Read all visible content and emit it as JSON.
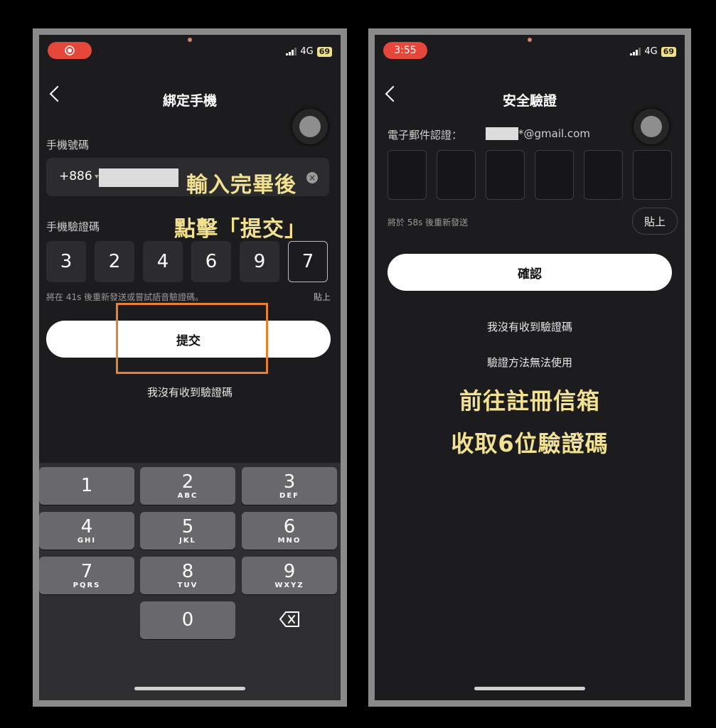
{
  "left": {
    "status": {
      "network": "4G",
      "battery": "69"
    },
    "title": "綁定手機",
    "phone_label": "手機號碼",
    "country_code": "+886",
    "annotation_line1": "輸入完畢後",
    "annotation_line2": "點擊「提交」",
    "code_label": "手機驗證碼",
    "code_digits": [
      "3",
      "2",
      "4",
      "6",
      "9",
      "7"
    ],
    "resend_hint": "將在 41s 後重新發送或嘗試語音驗證碼。",
    "paste_label": "貼上",
    "submit_label": "提交",
    "no_code_label": "我沒有收到驗證碼",
    "keypad": [
      {
        "num": "1",
        "letters": ""
      },
      {
        "num": "2",
        "letters": "ABC"
      },
      {
        "num": "3",
        "letters": "DEF"
      },
      {
        "num": "4",
        "letters": "GHI"
      },
      {
        "num": "5",
        "letters": "JKL"
      },
      {
        "num": "6",
        "letters": "MNO"
      },
      {
        "num": "7",
        "letters": "PQRS"
      },
      {
        "num": "8",
        "letters": "TUV"
      },
      {
        "num": "9",
        "letters": "WXYZ"
      },
      {
        "num": "0",
        "letters": ""
      }
    ]
  },
  "right": {
    "status": {
      "time": "3:55",
      "network": "4G",
      "battery": "69"
    },
    "title": "安全驗證",
    "email_label": "電子郵件認證：",
    "email_suffix": "*@gmail.com",
    "resend_hint": "將於 58s 後重新發送",
    "paste_label": "貼上",
    "confirm_label": "確認",
    "no_code_label": "我沒有收到驗證碼",
    "method_unavailable_label": "驗證方法無法使用",
    "annotation_line1": "前往註冊信箱",
    "annotation_line2": "收取6位驗證碼"
  },
  "colors": {
    "annotation": "#f2e191",
    "highlight_box": "#e8812f",
    "time_pill": "#e5473b"
  }
}
